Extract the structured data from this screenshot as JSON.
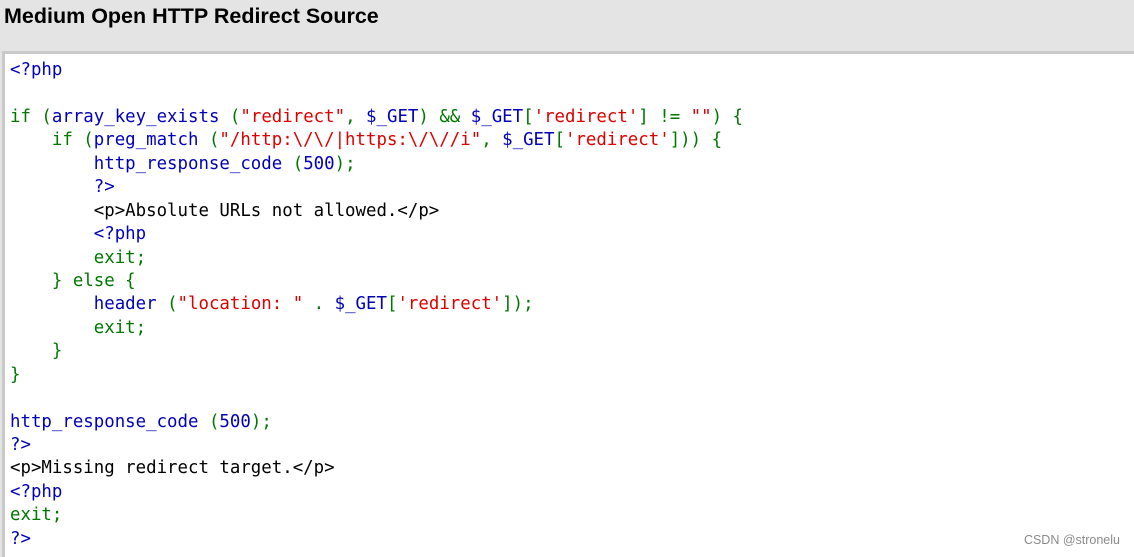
{
  "page": {
    "title": "Medium Open HTTP Redirect Source"
  },
  "colors": {
    "background": "#e4e4e4",
    "code_background": "#ffffff",
    "border": "#c9c9c9",
    "keyword": "#007700",
    "function": "#0000bb",
    "string": "#dd0000",
    "html": "#000000"
  },
  "code": {
    "lines": [
      [
        {
          "type": "func",
          "text": "<?php"
        }
      ],
      [
        {
          "type": "default",
          "text": ""
        }
      ],
      [
        {
          "type": "keyword",
          "text": "if ("
        },
        {
          "type": "func",
          "text": "array_key_exists "
        },
        {
          "type": "keyword",
          "text": "("
        },
        {
          "type": "string",
          "text": "\"redirect\""
        },
        {
          "type": "keyword",
          "text": ", "
        },
        {
          "type": "func",
          "text": "$_GET"
        },
        {
          "type": "keyword",
          "text": ") && "
        },
        {
          "type": "func",
          "text": "$_GET"
        },
        {
          "type": "keyword",
          "text": "["
        },
        {
          "type": "string",
          "text": "'redirect'"
        },
        {
          "type": "keyword",
          "text": "] != "
        },
        {
          "type": "string",
          "text": "\"\""
        },
        {
          "type": "keyword",
          "text": ") {"
        }
      ],
      [
        {
          "type": "keyword",
          "text": "    if ("
        },
        {
          "type": "func",
          "text": "preg_match "
        },
        {
          "type": "keyword",
          "text": "("
        },
        {
          "type": "string",
          "text": "\"/http:\\/\\/|https:\\/\\//i\""
        },
        {
          "type": "keyword",
          "text": ", "
        },
        {
          "type": "func",
          "text": "$_GET"
        },
        {
          "type": "keyword",
          "text": "["
        },
        {
          "type": "string",
          "text": "'redirect'"
        },
        {
          "type": "keyword",
          "text": "])) {"
        }
      ],
      [
        {
          "type": "func",
          "text": "        http_response_code "
        },
        {
          "type": "keyword",
          "text": "("
        },
        {
          "type": "func",
          "text": "500"
        },
        {
          "type": "keyword",
          "text": ");"
        }
      ],
      [
        {
          "type": "func",
          "text": "        ?>"
        }
      ],
      [
        {
          "type": "html",
          "text": "        <p>Absolute URLs not allowed.</p>"
        }
      ],
      [
        {
          "type": "func",
          "text": "        <?php"
        }
      ],
      [
        {
          "type": "keyword",
          "text": "        exit;"
        }
      ],
      [
        {
          "type": "keyword",
          "text": "    } else {"
        }
      ],
      [
        {
          "type": "func",
          "text": "        header "
        },
        {
          "type": "keyword",
          "text": "("
        },
        {
          "type": "string",
          "text": "\"location: \""
        },
        {
          "type": "keyword",
          "text": " . "
        },
        {
          "type": "func",
          "text": "$_GET"
        },
        {
          "type": "keyword",
          "text": "["
        },
        {
          "type": "string",
          "text": "'redirect'"
        },
        {
          "type": "keyword",
          "text": "]);"
        }
      ],
      [
        {
          "type": "keyword",
          "text": "        exit;"
        }
      ],
      [
        {
          "type": "keyword",
          "text": "    }"
        }
      ],
      [
        {
          "type": "keyword",
          "text": "}"
        }
      ],
      [
        {
          "type": "default",
          "text": ""
        }
      ],
      [
        {
          "type": "func",
          "text": "http_response_code "
        },
        {
          "type": "keyword",
          "text": "("
        },
        {
          "type": "func",
          "text": "500"
        },
        {
          "type": "keyword",
          "text": ");"
        }
      ],
      [
        {
          "type": "func",
          "text": "?>"
        }
      ],
      [
        {
          "type": "html",
          "text": "<p>Missing redirect target.</p>"
        }
      ],
      [
        {
          "type": "func",
          "text": "<?php"
        }
      ],
      [
        {
          "type": "keyword",
          "text": "exit;"
        }
      ],
      [
        {
          "type": "func",
          "text": "?>"
        }
      ]
    ]
  },
  "watermark": {
    "text": "CSDN @stronelu"
  }
}
